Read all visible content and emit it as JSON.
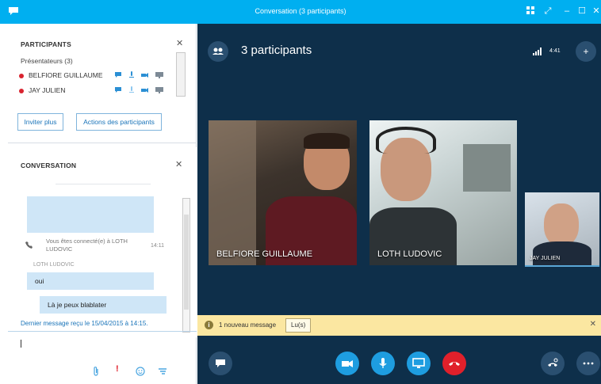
{
  "window": {
    "title": "Conversation (3 participants)",
    "accent": "#00aff0"
  },
  "participants_panel": {
    "title": "PARTICIPANTS",
    "presenters_label": "Présentateurs (3)",
    "people": [
      {
        "name": "BELFIORE GUILLAUME"
      },
      {
        "name": "JAY JULIEN"
      }
    ],
    "invite_button": "Inviter plus",
    "actions_button": "Actions des participants"
  },
  "conversation_panel": {
    "title": "CONVERSATION",
    "system_message": "Vous êtes connecté(e) à LOTH LUDOVIC",
    "system_time": "14:11",
    "sender": "LOTH LUDOVIC",
    "messages": [
      "oui",
      "Là je peux blablater"
    ],
    "last_message": "Dernier message reçu le 15/04/2015 à 14:15."
  },
  "call": {
    "header": "3 participants",
    "duration": "4:41",
    "videos": [
      {
        "name": "BELFIORE GUILLAUME"
      },
      {
        "name": "LOTH LUDOVIC"
      },
      {
        "name": "JAY JULIEN"
      }
    ],
    "notification": {
      "text": "1 nouveau message",
      "button": "Lu(s)"
    },
    "colors": {
      "background": "#0e2f4a",
      "control_blue": "#1e9de0",
      "hangup_red": "#e0202b",
      "notification": "#fbe7a1"
    }
  },
  "icons": [
    "app-chat-icon",
    "participants-icon",
    "signal-icon",
    "add-person-icon",
    "im-icon",
    "camera-icon",
    "microphone-icon",
    "screen-share-icon",
    "hang-up-icon",
    "device-icon",
    "more-icon",
    "attach-icon",
    "important-icon",
    "emoticon-icon",
    "send-icon"
  ]
}
